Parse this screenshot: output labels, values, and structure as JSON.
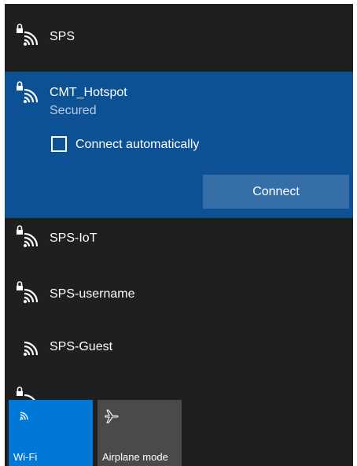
{
  "networks": [
    {
      "ssid": "SPS",
      "secured": true,
      "icon": "wifi-secured-icon"
    },
    {
      "ssid": "SPS-IoT",
      "secured": true,
      "icon": "wifi-secured-icon"
    },
    {
      "ssid": "SPS-username",
      "secured": true,
      "icon": "wifi-secured-icon"
    },
    {
      "ssid": "SPS-Guest",
      "secured": false,
      "icon": "wifi-icon"
    }
  ],
  "selected_network": {
    "ssid": "CMT_Hotspot",
    "status": "Secured",
    "auto_connect_label": "Connect automatically",
    "auto_connect_checked": false,
    "connect_label": "Connect"
  },
  "quick_actions": {
    "wifi_label": "Wi-Fi",
    "wifi_active": true,
    "airplane_label": "Airplane mode",
    "airplane_active": false
  },
  "colors": {
    "panel_bg": "#1f1f1f",
    "selected_bg": "#0b5193",
    "button_bg": "#366fa7",
    "wifi_tile_bg": "#0078d7",
    "airplane_tile_bg": "#4a4a4a",
    "secondary_text": "#b8cce2"
  }
}
